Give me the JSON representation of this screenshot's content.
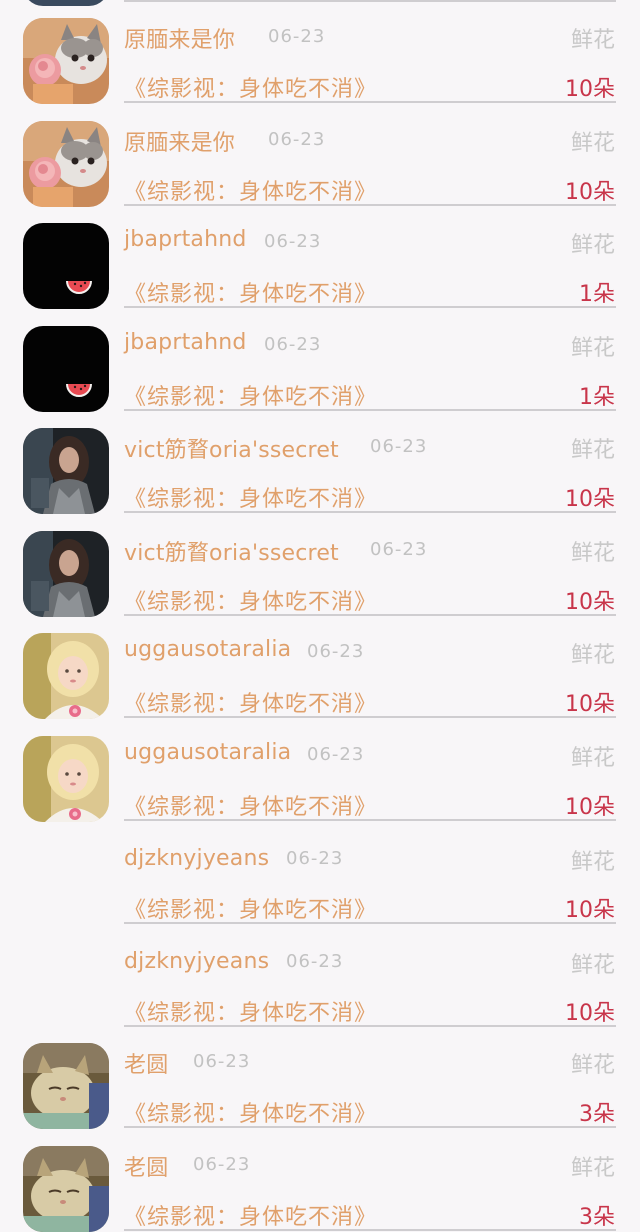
{
  "list": {
    "items": [
      {
        "name": "原腼来是你",
        "date": "06-23",
        "gift": "鲜花",
        "title": "《综影视：身体吃不消》",
        "count": "10朵",
        "avatar": "cat-with-rose-avatar"
      },
      {
        "name": "原腼来是你",
        "date": "06-23",
        "gift": "鲜花",
        "title": "《综影视：身体吃不消》",
        "count": "10朵",
        "avatar": "cat-with-rose-avatar"
      },
      {
        "name": "jbaprtahnd",
        "date": "06-23",
        "gift": "鲜花",
        "title": "《综影视：身体吃不消》",
        "count": "1朵",
        "avatar": "black-watermelon-avatar"
      },
      {
        "name": "jbaprtahnd",
        "date": "06-23",
        "gift": "鲜花",
        "title": "《综影视：身体吃不消》",
        "count": "1朵",
        "avatar": "black-watermelon-avatar"
      },
      {
        "name": "vict筋瞀oria'ssecret",
        "date": "06-23",
        "gift": "鲜花",
        "title": "《综影视：身体吃不消》",
        "count": "10朵",
        "avatar": "woman-portrait-avatar"
      },
      {
        "name": "vict筋瞀oria'ssecret",
        "date": "06-23",
        "gift": "鲜花",
        "title": "《综影视：身体吃不消》",
        "count": "10朵",
        "avatar": "woman-portrait-avatar"
      },
      {
        "name": "uggausotaralia",
        "date": "06-23",
        "gift": "鲜花",
        "title": "《综影视：身体吃不消》",
        "count": "10朵",
        "avatar": "child-with-flower-avatar"
      },
      {
        "name": "uggausotaralia",
        "date": "06-23",
        "gift": "鲜花",
        "title": "《综影视：身体吃不消》",
        "count": "10朵",
        "avatar": "child-with-flower-avatar"
      },
      {
        "name": "djzknyjyeans",
        "date": "06-23",
        "gift": "鲜花",
        "title": "《综影视：身体吃不消》",
        "count": "10朵",
        "avatar": "none"
      },
      {
        "name": "djzknyjyeans",
        "date": "06-23",
        "gift": "鲜花",
        "title": "《综影视：身体吃不消》",
        "count": "10朵",
        "avatar": "none"
      },
      {
        "name": "老圆",
        "date": "06-23",
        "gift": "鲜花",
        "title": "《综影视：身体吃不消》",
        "count": "3朵",
        "avatar": "sleeping-cat-avatar"
      },
      {
        "name": "老圆",
        "date": "06-23",
        "gift": "鲜花",
        "title": "《综影视：身体吃不消》",
        "count": "3朵",
        "avatar": "sleeping-cat-avatar"
      }
    ]
  },
  "colors": {
    "background": "#f8f6f8",
    "name": "#e0a06b",
    "date": "#c2c2c2",
    "gift": "#c8c8c8",
    "count": "#c8354a",
    "divider": "#cfcdd0"
  }
}
